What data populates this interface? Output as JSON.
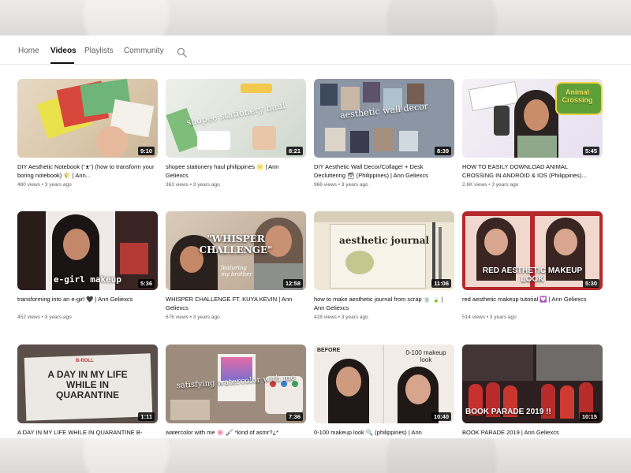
{
  "tabs": [
    {
      "label": "Home"
    },
    {
      "label": "Videos"
    },
    {
      "label": "Playlists"
    },
    {
      "label": "Community"
    }
  ],
  "icons": {
    "search": "search-icon"
  },
  "videos": [
    {
      "title": "DIY Aesthetic Notebook (ᵔᴥᵔ) (how to transform your boring notebook) 🌾 | Ann...",
      "views": "480 views",
      "age": "3 years ago",
      "duration": "9:10",
      "caption": ""
    },
    {
      "title": "shopee stationery haul philippines 🌝 | Ann Geliexcs",
      "views": "363 views",
      "age": "3 years ago",
      "duration": "8:21",
      "caption": "shopee stationery haul"
    },
    {
      "title": "DIY Aesthetic Wall Decor/Collage! + Desk Decluttering 🗃 (Philippines) | Ann Geliexcs",
      "views": "966 views",
      "age": "3 years ago",
      "duration": "8:39",
      "caption": "aesthetic wall decor"
    },
    {
      "title": "HOW TO EASILY DOWNLOAD ANIMAL CROSSING IN ANDROID & IOS (Philippines)...",
      "views": "2.6K views",
      "age": "3 years ago",
      "duration": "5:45",
      "caption": "Animal Crossing"
    },
    {
      "title": "transforming into an e-girl 🖤 | Ann Geliexcs",
      "views": "452 views",
      "age": "3 years ago",
      "duration": "5:36",
      "caption": "e-girl makeup"
    },
    {
      "title": "WHISPER CHALLENGE FT. KUYA KEVIN | Ann Geliexcs",
      "views": "676 views",
      "age": "3 years ago",
      "duration": "12:58",
      "caption": "\"WHISPER CHALLENGE\""
    },
    {
      "title": "how to make aesthetic journal from scrap 🍵 🍃 | Ann Geliexcs",
      "views": "428 views",
      "age": "3 years ago",
      "duration": "11:06",
      "caption": "aesthetic journal"
    },
    {
      "title": "red aesthetic makeup tutorial 💟 | Ann Geliexcs",
      "views": "514 views",
      "age": "3 years ago",
      "duration": "5:30",
      "caption": "RED AESTHETIC MAKEUP LOOK"
    },
    {
      "title": "A DAY IN MY LIFE WHILE IN QUARANTINE B-",
      "views": "",
      "age": "",
      "duration": "1:11",
      "caption": "A DAY IN MY LIFE WHILE IN QUARANTINE"
    },
    {
      "title": "watercolor with me 🌸 🖌 *kind of asmr?¿*",
      "views": "",
      "age": "",
      "duration": "7:36",
      "caption": "satisfying watercolor with me"
    },
    {
      "title": "0-100 makeup look 🔍 (philippines) | Ann",
      "views": "",
      "age": "",
      "duration": "10:40",
      "caption": "0-100 makeup look"
    },
    {
      "title": "BOOK PARADE 2019 | Ann Geliexcs",
      "views": "",
      "age": "",
      "duration": "10:15",
      "caption": "BOOK PARADE 2019 !!"
    }
  ],
  "thumb_texts": {
    "before": "BEFORE",
    "broll": "B-ROLL",
    "featuring": "featuring my brother"
  }
}
